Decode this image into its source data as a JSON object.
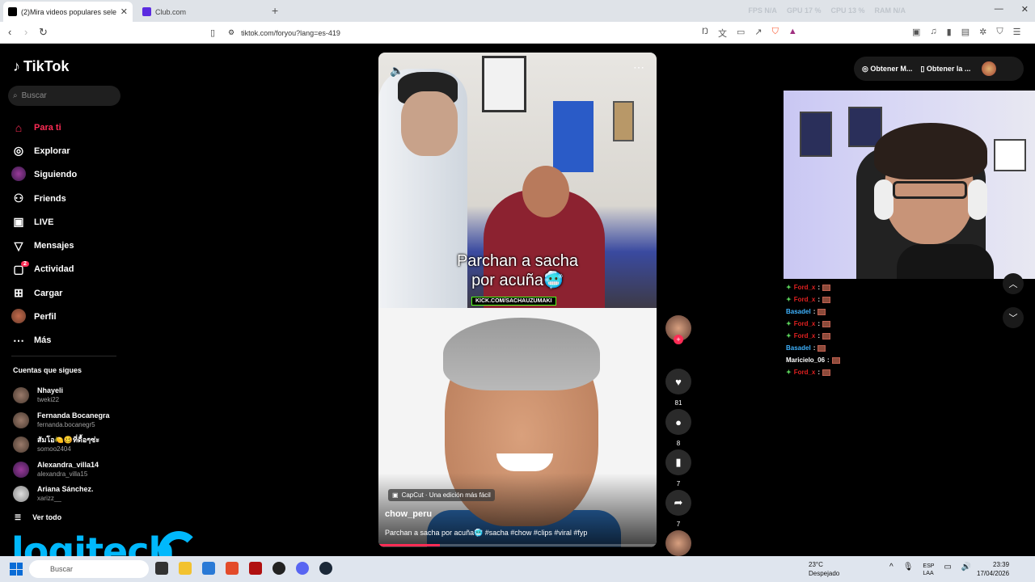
{
  "browser": {
    "tabs": [
      {
        "title": "(2)Mira videos populares sele",
        "active": true
      },
      {
        "title": "Club.com",
        "active": false
      }
    ],
    "stats": {
      "fps": "FPS N/A",
      "gpu": "GPU 17 %",
      "cpu": "CPU 13 %",
      "ram": "RAM N/A"
    },
    "url": "tiktok.com/foryou?lang=es-419"
  },
  "tiktok": {
    "brand": "TikTok",
    "search_placeholder": "Buscar",
    "nav": [
      {
        "label": "Para ti",
        "icon": "home-icon"
      },
      {
        "label": "Explorar",
        "icon": "compass-icon"
      },
      {
        "label": "Siguiendo",
        "icon": "avatar-icon"
      },
      {
        "label": "Friends",
        "icon": "people-icon"
      },
      {
        "label": "LIVE",
        "icon": "tv-icon"
      },
      {
        "label": "Mensajes",
        "icon": "send-icon"
      },
      {
        "label": "Actividad",
        "icon": "bell-icon",
        "badge": "2"
      },
      {
        "label": "Cargar",
        "icon": "plus-icon"
      },
      {
        "label": "Perfil",
        "icon": "avatar-icon"
      },
      {
        "label": "Más",
        "icon": "more-icon"
      }
    ],
    "following_title": "Cuentas que sigues",
    "following": [
      {
        "name": "Nhayeli",
        "handle": "tweki22"
      },
      {
        "name": "Fernanda Bocanegra",
        "handle": "fernanda.bocanegr5"
      },
      {
        "name": "สัมโอ🍋🥴ที่ดื้อๆซ่ะ",
        "handle": "somoo2404"
      },
      {
        "name": "Alexandra_villa14",
        "handle": "alexandra_villa15"
      },
      {
        "name": "Ariana Sánchez.",
        "handle": "xarizz__"
      }
    ],
    "see_all": "Ver todo",
    "video": {
      "caption_line1": "Parchan a sacha",
      "caption_line2": "por acuña🥶",
      "kick": "KICK.COM/SACHAUZUMAKI",
      "capcut": "CapCut · Una edición más fácil",
      "author": "chow_peru",
      "description": "Parchan a sacha por acuña🥶 #sacha #chow #clips #viral #fyp",
      "progress": 0.22
    },
    "actions": {
      "likes": "81",
      "comments": "8",
      "saves": "7",
      "shares": "7"
    },
    "header_buttons": [
      "Obtener M...",
      "Obtener la ..."
    ]
  },
  "chat": [
    {
      "user": "Ford_x",
      "color": "#e02020"
    },
    {
      "user": "Ford_x",
      "color": "#e02020"
    },
    {
      "user": "Basadel",
      "color": "#3fb3ff"
    },
    {
      "user": "Ford_x",
      "color": "#e02020"
    },
    {
      "user": "Ford_x",
      "color": "#e02020"
    },
    {
      "user": "Basadel",
      "color": "#3fb3ff"
    },
    {
      "user": "Maricielo_06",
      "color": "#ffffff"
    },
    {
      "user": "Ford_x",
      "color": "#e02020"
    }
  ],
  "overlay": {
    "logo": "logitech"
  },
  "taskbar": {
    "search": "Buscar",
    "weather_temp": "23°C",
    "weather_desc": "Despejado",
    "lang1": "ESP",
    "lang2": "LAA",
    "time": "23:39",
    "date": "17/04/2026"
  }
}
